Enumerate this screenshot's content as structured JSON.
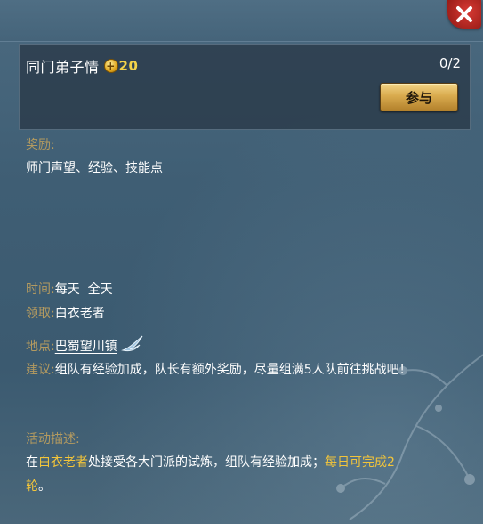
{
  "task": {
    "title": "同门弟子情",
    "reward_amount": "20",
    "progress": "0/2",
    "join_label": "参与"
  },
  "reward": {
    "label": "奖励:",
    "text": "师门声望、经验、技能点"
  },
  "info": {
    "time_label": "时间:",
    "time_value": "每天  全天",
    "claim_label": "领取:",
    "claim_value": "白衣老者",
    "location_label": "地点:",
    "location_value": "巴蜀望川镇",
    "advice_label": "建议:",
    "advice_value": "组队有经验加成，队长有额外奖励，尽量组满5人队前往挑战吧！"
  },
  "description": {
    "label": "活动描述:",
    "part1": "在",
    "npc": "白衣老者",
    "part2": "处接受各大门派的试炼，组队有经验加成；",
    "highlight": "每日可完成2轮",
    "end": "。"
  },
  "colors": {
    "label": "#b39a60",
    "text": "#ffffff",
    "highlight": "#f3c53a",
    "close_button": "#c8302b"
  },
  "icons": [
    "close-icon",
    "coin-icon",
    "wing-icon"
  ]
}
